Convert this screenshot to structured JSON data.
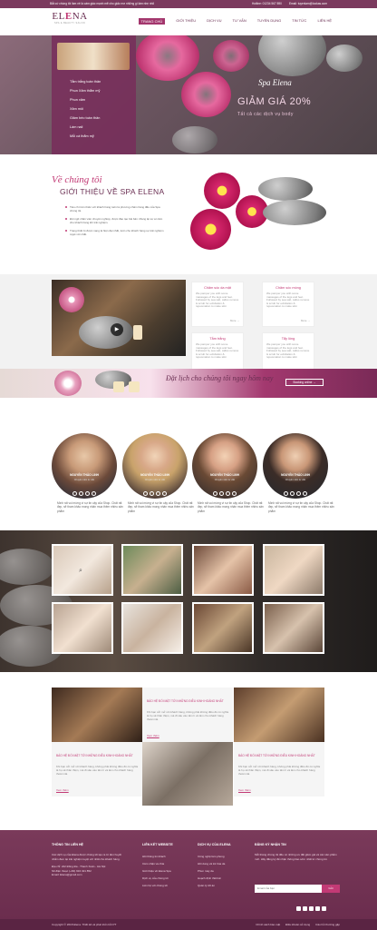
{
  "topbar": {
    "left_text": "Bắt cứ chúng tôi làm về là cám giác mạnh mẽ cho giấc mơ những gì làm nhẹ nhõ",
    "hotline": "Hotline: 01234 567 890",
    "email": "Email: tuyenlam@lookas.com"
  },
  "logo": {
    "part1": "EL",
    "part2": "E",
    "part3": "NA",
    "tagline": "SPA & BEAUTY SALON"
  },
  "nav": [
    "TRANG CHỦ",
    "GIỚI THIỆU",
    "DỊCH VỤ",
    "TƯ VẤN",
    "TUYỂN DỤNG",
    "TIN TỨC",
    "LIÊN HỆ"
  ],
  "sidebar": [
    "Tắm trắng toàn thân",
    "Phun Xăm thẩm mỹ",
    "Phun xăm",
    "Xăm môi",
    "Giảm béo toàn thân",
    "Làm nail",
    "Mỗi cá thẩm mỹ"
  ],
  "hero": {
    "title": "Spa Elena",
    "sale": "GIẢM GIÁ 20%",
    "sub": "Tất cả các dịch vụ body"
  },
  "intro": {
    "eyebrow": "Về chúng tôi",
    "heading": "GIỚI THIỆU VỀ SPA ELENA",
    "bullets": [
      "Tiêu chí trên thiên với khách hàng luôn là phương châm hàng đầu của Spa chúng tôi.",
      "Đội ngũ nhân viên chuyên nghiệp, được đào tạo bài bản. Mang lại sự an tâm cho khách hàng khi trải nghiệm.",
      "Trang thiết bị được nang là hiện đại nhất, luôn cho khách hàng sự trải nghiệm tuyệt vời nhất."
    ]
  },
  "services": [
    {
      "name": "Chăm sóc da mặt",
      "desc": "We pamper you with some massages of the legs and feet. Followed by sea salt, callus remove & scrub for exfoliation & rejuvenation to make skin",
      "more": "More →"
    },
    {
      "name": "Chăm sóc móng",
      "desc": "We pamper you with some massages of the legs and feet. Followed by sea salt, callus remove & scrub for exfoliation & rejuvenation to make skin",
      "more": "More →"
    },
    {
      "name": "Tắm trắng",
      "desc": "We pamper you with some massages of the legs and feet. Followed by sea salt, callus remove & scrub for exfoliation & rejuvenation to make skin",
      "more": "More →"
    },
    {
      "name": "Tẩy lông",
      "desc": "We pamper you with some massages of the legs and feet. Followed by sea salt, callus remove & scrub for exfoliation & rejuvenation to make skin",
      "more": "More →"
    }
  ],
  "banner": {
    "text": "Đặt lịch cho chúng tôi ngay hôm nay",
    "button": "Booking online →"
  },
  "team": [
    {
      "name": "NGUYỄN THẢO LINH",
      "role": "Chuyên viên tư vấn",
      "desc": "Mình rất vui mừng vì sự tin cậy của Shop. Chất rất đẹp, sẽ tham khảo mong nhân mua thêm nhiều sản phẩm"
    },
    {
      "name": "NGUYỄN THẢO LINH",
      "role": "Chuyên viên tư vấn",
      "desc": "Mình rất vui mừng vì sự tin cậy của Shop. Chất rất đẹp, sẽ tham khảo mong nhân mua thêm nhiều sản phẩm"
    },
    {
      "name": "NGUYỄN THẢO LINH",
      "role": "Chuyên viên tư vấn",
      "desc": "Mình rất vui mừng vì sự tin cậy của Shop. Chất rất đẹp, sẽ tham khảo mong nhân mua thêm nhiều sản phẩm"
    },
    {
      "name": "NGUYỄN THẢO LINH",
      "role": "Chuyên viên tư vấn",
      "desc": "Mình rất vui mừng vì sự tin cậy của Shop. Chất rất đẹp, sẽ tham khảo mong nhân mua thêm nhiều sản phẩm"
    }
  ],
  "posts": [
    {
      "title": "BÁO HỆ ĐỐI MẶT TỚI NHỮNG ĐIỀU KINH HOÀNG NHẤT",
      "desc": "Khi bạn cởi mở với khách hàng, không phải không điều đó có nghĩa là họ sẽ thân thiện, mà đi sâu vào tâm lí và làm cho khách hàng thoải mái.",
      "more": "Xem thêm"
    },
    {
      "title": "BÁO HỆ ĐỐI MẶT TỚI NHỮNG ĐIỀU KINH HOÀNG NHẤT",
      "desc": "Khi bạn cởi mở với khách hàng, không phải không điều đó có nghĩa là họ sẽ thân thiện, mà đi sâu vào tâm lí và làm cho khách hàng thoải mái.",
      "more": "Xem thêm"
    },
    {
      "title": "BÁO HỆ ĐỐI MẶT TỚI NHỮNG ĐIỀU KINH HOÀNG NHẤT",
      "desc": "Khi bạn cởi mở với khách hàng, không phải không điều đó có nghĩa là họ sẽ thân thiện, mà đi sâu vào tâm lí và làm cho khách hàng thoải mái.",
      "more": "Xem thêm"
    }
  ],
  "footer": {
    "contact": {
      "title": "THÔNG TIN LIÊN HỆ",
      "text": "Các dịch vụ của Elena được chúng tôi tạo ra từ tâm huyết nhằm đem lại trải nghiệm tuyệt vời nhất cho khách hàng.",
      "address": "Địa chỉ: 222 Đống Đa - Thanh Xuân - Hà Nội",
      "phone": "Số điện thoại: (+84) 934 321 852",
      "email": "Email: Elena@gmail.com"
    },
    "links": {
      "title": "LIÊN KẾT WEBSITE",
      "items": [
        "Hồi thông tin khách",
        "Cảm nhận và chia",
        "Giới thiệu về Elena Spa",
        "Dịch vụ của chúng tôi",
        "Liên hệ với chúng tôi"
      ]
    },
    "services": {
      "title": "DỊCH VỤ CỦA ELENA",
      "items": [
        "Công nghệ làm phong",
        "Hồi dung và trẻ hóa da",
        "Phun mày da",
        "Hoạch định thiết kế",
        "Quản lý dữ án"
      ]
    },
    "newsletter": {
      "title": "ĐĂNG KÝ NHẬN TIN",
      "text": "Mỗi tháng chúng tôi đều có những ưu đãi giảm giá và các sản phẩm mới. Hãy đăng ký để nhận thông báo sớm nhất từ chúng tôi.",
      "placeholder": "Email của bạn",
      "button": "Gửi"
    },
    "copyright": "Copyright © 2018 Elena. Thiết kế và phát triển bởi PT",
    "bottom_links": [
      "Chính sách bảo mật",
      "Điều khoản sử dụng",
      "Câu hỏi thường gặp"
    ]
  },
  "colors": {
    "primary": "#7b3a5e",
    "accent": "#c23a75"
  }
}
